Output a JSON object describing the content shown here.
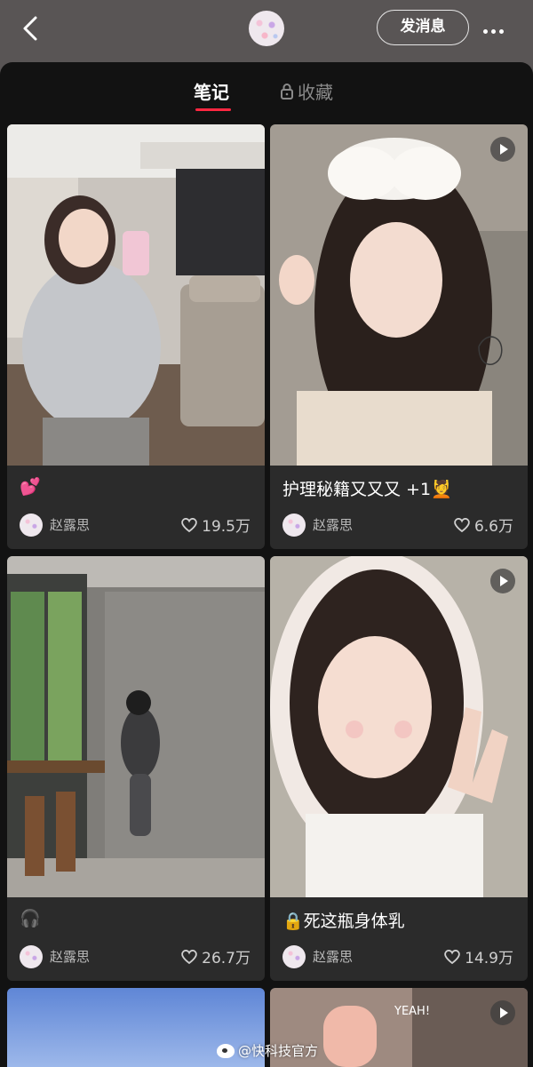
{
  "header": {
    "back_icon": "chevron-left-icon",
    "send_message_label": "发消息",
    "more_icon": "more-horizontal-icon"
  },
  "tabs": [
    {
      "label": "笔记",
      "active": true
    },
    {
      "label": "收藏",
      "locked": true
    }
  ],
  "notes": [
    {
      "title": "💕",
      "author": "赵露思",
      "likes": "19.5万",
      "is_video": false
    },
    {
      "title": "护理秘籍又又又 +1💆",
      "author": "赵露思",
      "likes": "6.6万",
      "is_video": true
    },
    {
      "title": "🎧",
      "author": "赵露思",
      "likes": "26.7万",
      "is_video": false
    },
    {
      "title": "🔒死这瓶身体乳",
      "author": "赵露思",
      "likes": "14.9万",
      "is_video": true
    },
    {
      "title": "",
      "author": "",
      "likes": "",
      "is_video": false
    },
    {
      "title": "",
      "author": "",
      "likes": "",
      "is_video": true,
      "overlay_text": "YEAH!"
    }
  ],
  "watermark": "@快科技官方",
  "colors": {
    "background": "#121212",
    "card": "#2b2b2b",
    "accent": "#ff2741"
  }
}
